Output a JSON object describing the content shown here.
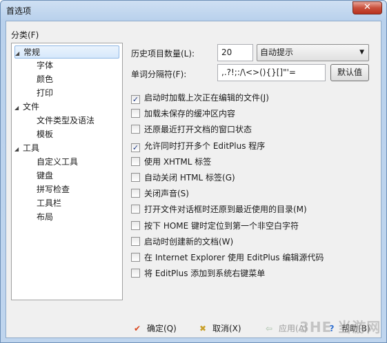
{
  "window": {
    "title": "首选项",
    "close_label": "✕"
  },
  "category": {
    "label": "分类(F)",
    "tree": [
      {
        "label": "常规",
        "level": 0,
        "expanded": true,
        "selected": true
      },
      {
        "label": "字体",
        "level": 1
      },
      {
        "label": "颜色",
        "level": 1
      },
      {
        "label": "打印",
        "level": 1
      },
      {
        "label": "文件",
        "level": 0,
        "expanded": true
      },
      {
        "label": "文件类型及语法",
        "level": 1
      },
      {
        "label": "模板",
        "level": 1
      },
      {
        "label": "工具",
        "level": 0,
        "expanded": true
      },
      {
        "label": "自定义工具",
        "level": 1
      },
      {
        "label": "键盘",
        "level": 1
      },
      {
        "label": "拼写检查",
        "level": 1
      },
      {
        "label": "工具栏",
        "level": 1
      },
      {
        "label": "布局",
        "level": 1
      }
    ]
  },
  "history": {
    "label": "历史项目数量(L):",
    "value": "20",
    "dropdown_value": "自动提示"
  },
  "word_separator": {
    "label": "单词分隔符(F):",
    "value": ",.?!;:/\\<>(){}[]\"'=",
    "default_button": "默认值"
  },
  "options": [
    {
      "label": "启动时加载上次正在编辑的文件(J)",
      "checked": true
    },
    {
      "label": "加载未保存的缓冲区内容",
      "checked": false
    },
    {
      "label": "还原最近打开文档的窗口状态",
      "checked": false
    },
    {
      "label": "允许同时打开多个 EditPlus 程序",
      "checked": true
    },
    {
      "label": "使用 XHTML 标签",
      "checked": false
    },
    {
      "label": "自动关闭 HTML 标签(G)",
      "checked": false
    },
    {
      "label": "关闭声音(S)",
      "checked": false
    },
    {
      "label": "打开文件对话框时还原到最近使用的目录(M)",
      "checked": false
    },
    {
      "label": "按下 HOME 键时定位到第一个非空白字符",
      "checked": false
    },
    {
      "label": "启动时创建新的文档(W)",
      "checked": false
    },
    {
      "label": "在 Internet Explorer 使用 EditPlus 编辑源代码",
      "checked": false
    },
    {
      "label": "将 EditPlus 添加到系统右键菜单",
      "checked": false
    }
  ],
  "footer": {
    "ok": "确定(Q)",
    "cancel": "取消(X)",
    "apply": "应用(A)",
    "help": "帮助(B)",
    "ok_icon": "✔",
    "cancel_icon": "✖",
    "apply_icon": "⇦",
    "help_icon": "?"
  },
  "watermark": "3HE 当游网",
  "colors": {
    "ok_icon": "#d9451c",
    "cancel_icon": "#c9a02a",
    "help_icon": "#2f6fd0",
    "check": "#1f3a84"
  }
}
